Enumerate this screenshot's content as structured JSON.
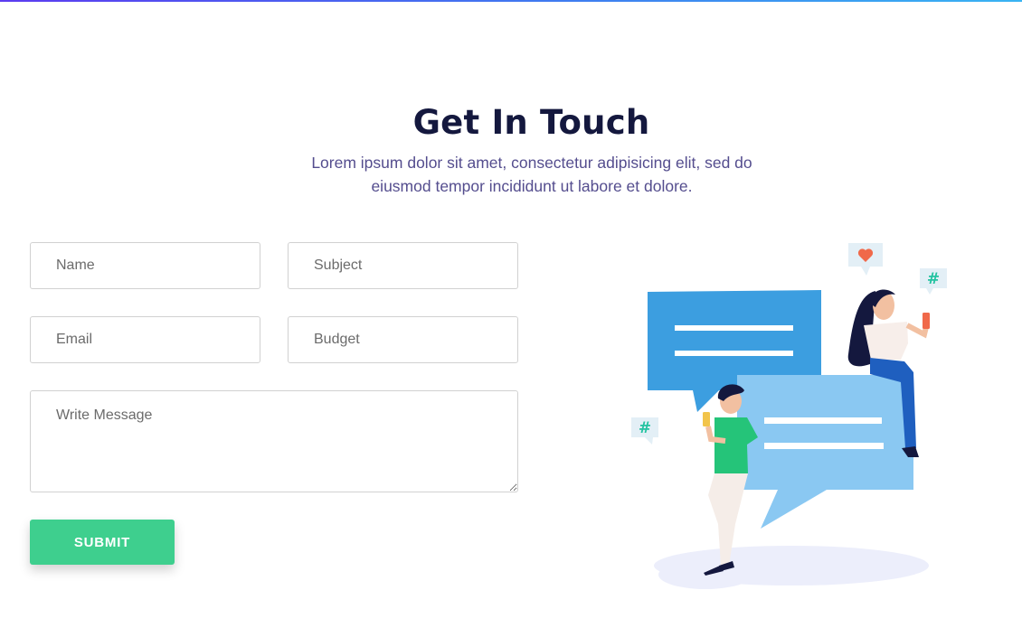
{
  "header": {
    "title": "Get In Touch",
    "subtitle_line1": "Lorem ipsum dolor sit amet, consectetur adipisicing elit, sed do",
    "subtitle_line2": "eiusmod tempor incididunt ut labore et dolore."
  },
  "form": {
    "name_placeholder": "Name",
    "subject_placeholder": "Subject",
    "email_placeholder": "Email",
    "budget_placeholder": "Budget",
    "message_placeholder": "Write Message",
    "submit_label": "SUBMIT"
  },
  "illustration": {
    "hash_symbol": "#"
  },
  "colors": {
    "accent_green": "#3ecf8e",
    "title_navy": "#14183e",
    "subtitle_purple": "#544d8e",
    "bubble_blue": "#3c9ee0",
    "bubble_light_blue": "#8ac8f2"
  }
}
